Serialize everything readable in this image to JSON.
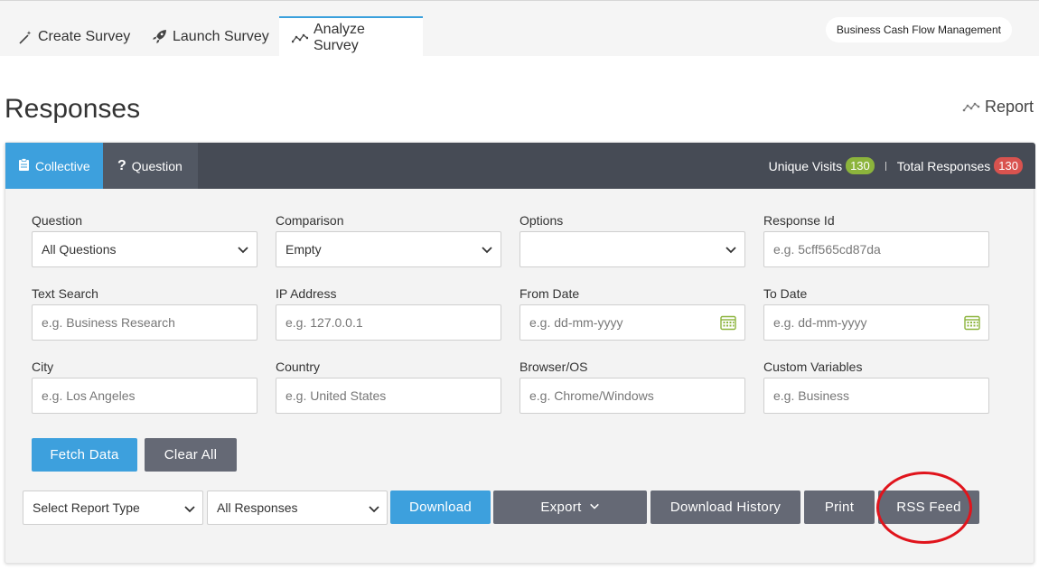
{
  "top_tabs": [
    {
      "label": "Create Survey",
      "icon": "magic-wand-icon"
    },
    {
      "label": "Launch Survey",
      "icon": "rocket-icon"
    },
    {
      "label": "Analyze Survey",
      "icon": "line-chart-icon",
      "active": true
    }
  ],
  "survey_name": "Business Cash Flow Management",
  "page_title": "Responses",
  "report_link": "Report",
  "card_tabs": [
    {
      "label": "Collective",
      "icon": "clipboard-icon",
      "active": true
    },
    {
      "label": "Question",
      "icon": "question-mark-icon"
    }
  ],
  "stats": {
    "unique_visits_label": "Unique Visits",
    "unique_visits": "130",
    "total_responses_label": "Total Responses",
    "total_responses": "130"
  },
  "filters": {
    "question": {
      "label": "Question",
      "value": "All Questions"
    },
    "comparison": {
      "label": "Comparison",
      "value": "Empty"
    },
    "options": {
      "label": "Options",
      "value": ""
    },
    "response_id": {
      "label": "Response Id",
      "placeholder": "e.g. 5cff565cd87da"
    },
    "text_search": {
      "label": "Text Search",
      "placeholder": "e.g. Business Research"
    },
    "ip_address": {
      "label": "IP Address",
      "placeholder": "e.g. 127.0.0.1"
    },
    "from_date": {
      "label": "From Date",
      "placeholder": "e.g. dd-mm-yyyy"
    },
    "to_date": {
      "label": "To Date",
      "placeholder": "e.g. dd-mm-yyyy"
    },
    "city": {
      "label": "City",
      "placeholder": "e.g. Los Angeles"
    },
    "country": {
      "label": "Country",
      "placeholder": "e.g. United States"
    },
    "browser_os": {
      "label": "Browser/OS",
      "placeholder": "e.g. Chrome/Windows"
    },
    "custom_variables": {
      "label": "Custom Variables",
      "placeholder": "e.g. Business"
    }
  },
  "actions": {
    "fetch": "Fetch Data",
    "clear": "Clear All"
  },
  "report_bar": {
    "report_type": "Select Report Type",
    "responses": "All Responses",
    "download": "Download",
    "export": "Export",
    "download_history": "Download History",
    "print": "Print",
    "rss_feed": "RSS Feed"
  },
  "colors": {
    "accent_blue": "#3da0dd",
    "header_dark": "#464b55",
    "button_gray": "#656975",
    "badge_green": "#8cb43c",
    "badge_red": "#d9534f",
    "annotation_red": "#e0141c"
  }
}
